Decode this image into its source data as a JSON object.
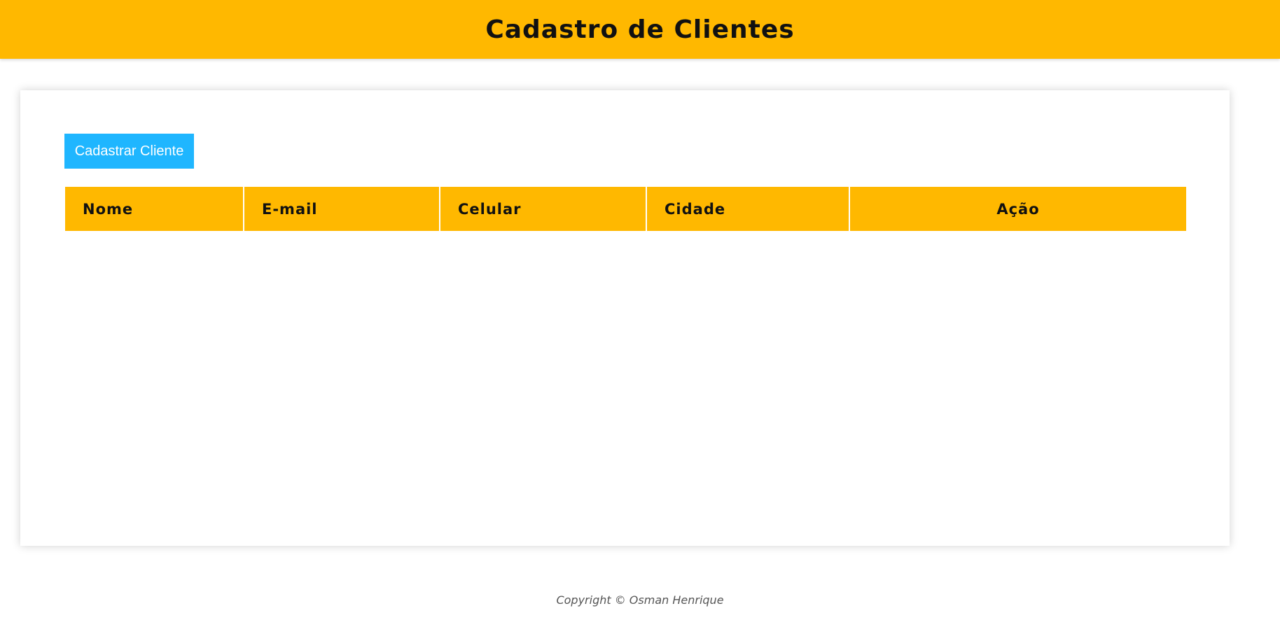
{
  "header": {
    "title": "Cadastro de Clientes"
  },
  "toolbar": {
    "add_client_label": "Cadastrar Cliente"
  },
  "table": {
    "columns": [
      "Nome",
      "E-mail",
      "Celular",
      "Cidade",
      "Ação"
    ],
    "rows": []
  },
  "footer": {
    "copyright": "Copyright © Osman Henrique"
  },
  "colors": {
    "header_background": "#ffb800",
    "table_header_background": "#ffb800",
    "button_background": "#1fb6ff",
    "footer_text": "#555555"
  }
}
